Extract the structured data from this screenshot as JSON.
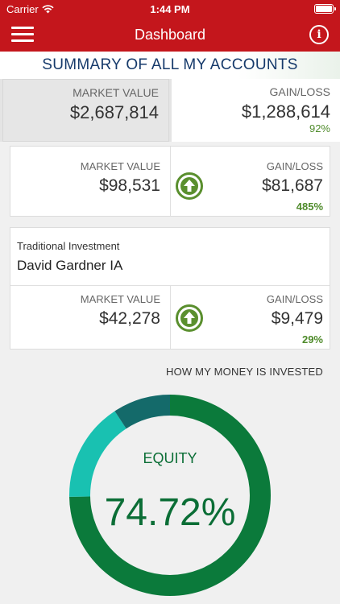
{
  "status_bar": {
    "carrier": "Carrier",
    "time": "1:44 PM"
  },
  "nav": {
    "title": "Dashboard"
  },
  "summary": {
    "title": "SUMMARY OF ALL MY ACCOUNTS",
    "market_value_label": "MARKET VALUE",
    "market_value": "$2,687,814",
    "gain_loss_label": "GAIN/LOSS",
    "gain_loss": "$1,288,614",
    "gain_loss_pct": "92%"
  },
  "accounts": [
    {
      "market_value_label": "MARKET VALUE",
      "market_value": "$98,531",
      "gain_loss_label": "GAIN/LOSS",
      "gain_loss": "$81,687",
      "gain_loss_pct": "485%"
    },
    {
      "type": "Traditional Investment",
      "name": "David Gardner IA",
      "market_value_label": "MARKET VALUE",
      "market_value": "$42,278",
      "gain_loss_label": "GAIN/LOSS",
      "gain_loss": "$9,479",
      "gain_loss_pct": "29%"
    }
  ],
  "allocation": {
    "title": "HOW MY MONEY IS INVESTED",
    "center_label": "EQUITY",
    "center_value": "74.72%",
    "segments": [
      {
        "value": 74.72,
        "color": "#0b7a3b"
      },
      {
        "value": 16.0,
        "color": "#19c1b1"
      },
      {
        "value": 9.28,
        "color": "#146a6a"
      }
    ]
  },
  "colors": {
    "brand_red": "#c4161c",
    "gain_green": "#5a8f2e"
  },
  "icons": [
    "wifi-icon",
    "battery-icon",
    "menu-icon",
    "info-icon",
    "arrow-up-icon"
  ]
}
